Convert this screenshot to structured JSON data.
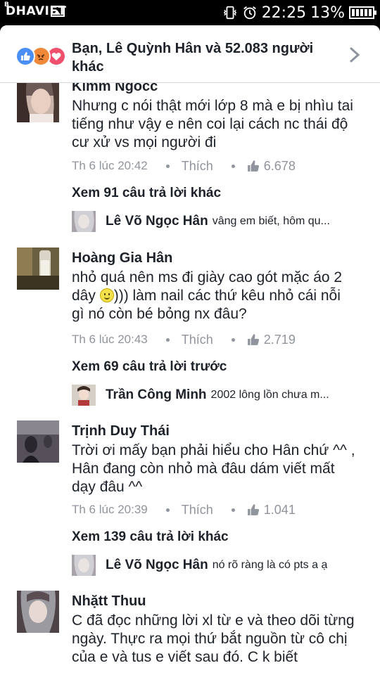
{
  "status_bar": {
    "logo": "DHAVIET",
    "logo_small": "B",
    "time": "22:25",
    "battery": "13%"
  },
  "reactions": {
    "summary": "Bạn, Lê Quỳnh Hân và 52.083 người khác",
    "icons": [
      "like-icon",
      "angry-icon",
      "love-icon"
    ]
  },
  "comments": [
    {
      "name": "Kimm Ngocc",
      "text": "Nhưng c nói thật mới lớp 8 mà e bị nhìu tai tiếng như vậy e nên coi lại cách nc thái độ cư xử vs mọi người đi",
      "time": "Th 6 lúc 20:42",
      "like_label": "Thích",
      "likes": "6.678",
      "more_replies": "Xem 91 câu trả lời khác",
      "reply": {
        "name": "Lê Võ Ngọc Hân",
        "text": "vâng em biết, hôm qu..."
      }
    },
    {
      "name": "Hoàng Gia Hân",
      "text_line1": "nhỏ quá nên ms đi giày cao gót mặc áo 2",
      "text_line2_before": "dây ",
      "text_line2_after": "))) làm nail các thứ kêu nhỏ cái nỗi",
      "text_line3": "gì nó còn bé bỏng nx đâu?",
      "time": "Th 6 lúc 20:43",
      "like_label": "Thích",
      "likes": "2.719",
      "more_replies": "Xem 69 câu trả lời trước",
      "reply": {
        "name": "Trần Công Minh",
        "text": "2002 lông lồn chưa m..."
      }
    },
    {
      "name": "Trịnh Duy Thái",
      "text": "Trời ơi mấy bạn phải hiểu cho Hân chứ ^^ , Hân đang còn nhỏ mà đâu dám viết mất dạy đâu ^^",
      "time": "Th 6 lúc 20:39",
      "like_label": "Thích",
      "likes": "1.041",
      "more_replies": "Xem 139 câu trả lời khác",
      "reply": {
        "name": "Lê Võ Ngọc Hân",
        "text": "nó rõ ràng là có pts a ạ"
      }
    },
    {
      "name": "Nhặtt Thuu",
      "text": "C đã đọc những lời xl từ e và theo dõi từng ngày. Thực ra mọi thứ bắt nguồn từ cô chị của e và tus e viết sau đó. C k biết"
    }
  ]
}
